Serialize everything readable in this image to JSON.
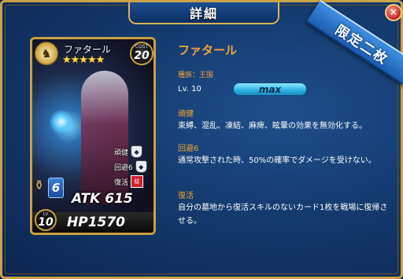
{
  "window": {
    "title": "詳細",
    "close_glyph": "✕",
    "ribbon": "限定二枚"
  },
  "card": {
    "name": "ファタール",
    "rarity_stars": "★★★★★",
    "cost_label": "COST",
    "cost": "20",
    "skills": [
      {
        "label": "頑健",
        "icon": "shield-icon",
        "glyph": "◆"
      },
      {
        "label": "回避6",
        "icon": "shield-icon",
        "glyph": "◆"
      },
      {
        "label": "復活",
        "icon": "revive-icon",
        "glyph": "紋"
      }
    ],
    "tier": "6",
    "atk_label": "ATK",
    "atk": "615",
    "hp_label": "HP",
    "hp": "1570",
    "lv_label": "LV",
    "lv": "10"
  },
  "info": {
    "name": "ファタール",
    "race": "種族：王国",
    "level": "Lv. 10",
    "max_label": "max",
    "abilities": [
      {
        "name": "頑健",
        "desc": "束縛、混乱、凍結、麻痺、眩暈の効果を無効化する。"
      },
      {
        "name": "回避6",
        "desc": "通常攻撃された時、50%の確率でダメージを受けない。"
      },
      {
        "name": "復活",
        "desc": "自分の墓地から復活スキルのないカード1枚を戦場に復帰させる。"
      }
    ]
  },
  "colors": {
    "accent": "#f5a431",
    "frame": "#c9a24a",
    "background": "#143a6e"
  }
}
